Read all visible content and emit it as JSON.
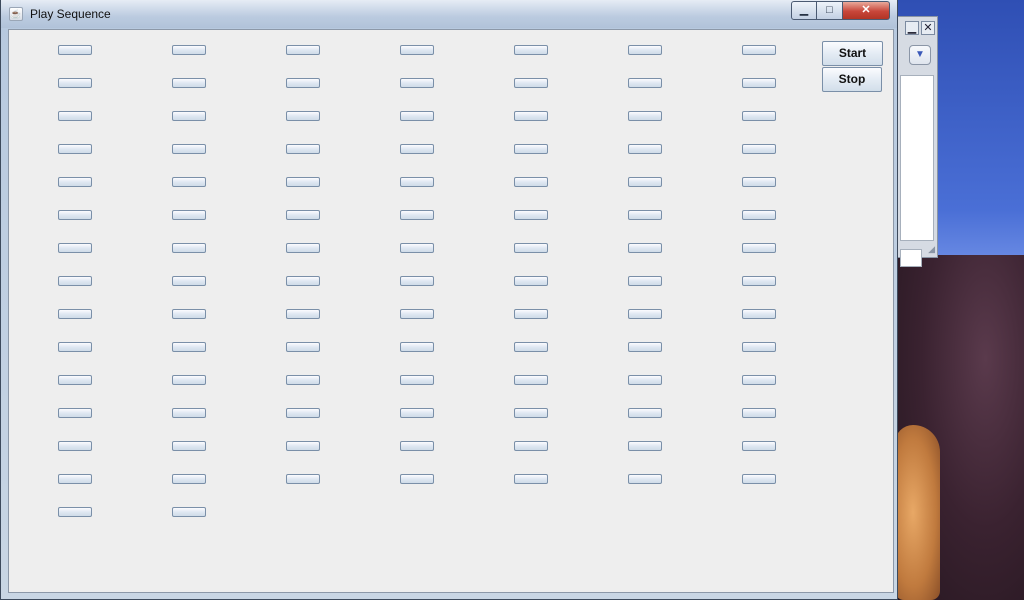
{
  "window": {
    "title": "Play Sequence"
  },
  "caption_buttons": {
    "minimize": "▁",
    "maximize": "□",
    "close": "✕"
  },
  "controls": {
    "start_label": "Start",
    "stop_label": "Stop"
  },
  "grid": {
    "columns": 7,
    "rows": 15,
    "total_buttons": 100
  },
  "background_window": {
    "combo_arrow": "▼"
  }
}
